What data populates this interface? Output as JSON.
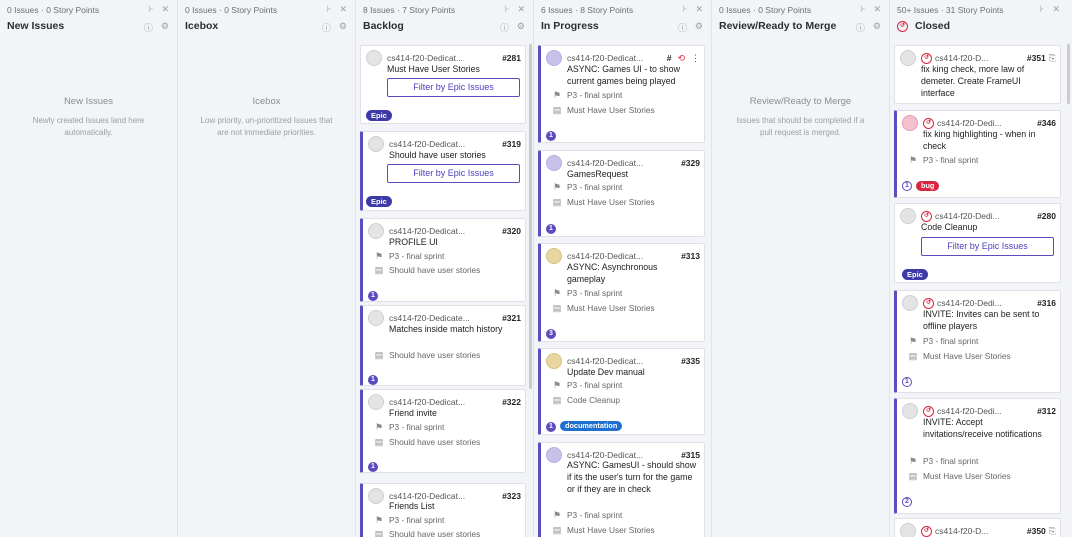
{
  "columns": {
    "new": {
      "meta": "0 Issues · 0 Story Points",
      "title": "New Issues",
      "empty_title": "New Issues",
      "empty_desc": "Newly created Issues land here automatically."
    },
    "icebox": {
      "meta": "0 Issues · 0 Story Points",
      "title": "Icebox",
      "empty_title": "Icebox",
      "empty_desc": "Low priority, un-prioritized Issues that are not immediate priorities."
    },
    "backlog": {
      "meta": "8 Issues · 7 Story Points",
      "title": "Backlog"
    },
    "progress": {
      "meta": "6 Issues · 8 Story Points",
      "title": "In Progress"
    },
    "review": {
      "meta": "0 Issues · 0 Story Points",
      "title": "Review/Ready to Merge",
      "empty_title": "Review/Ready to Merge",
      "empty_desc": "Issues that should be completed if a pull request is merged."
    },
    "closed": {
      "meta": "50+ Issues · 31 Story Points",
      "title": "Closed"
    }
  },
  "common": {
    "filter_epic": "Filter by Epic Issues",
    "epic": "Epic",
    "p3": "P3 - final sprint",
    "must": "Must Have User Stories",
    "should": "Should have user stories",
    "cleanup": "Code Cleanup"
  },
  "backlog_cards": [
    {
      "repo": "cs414-f20-Dedicat...",
      "num": "#281",
      "title": "Must Have User Stories"
    },
    {
      "repo": "cs414-f20-Dedicat...",
      "num": "#319",
      "title": "Should have user stories"
    },
    {
      "repo": "cs414-f20-Dedicat...",
      "num": "#320",
      "title": "PROFILE UI",
      "badge": "1"
    },
    {
      "repo": "cs414-f20-Dedicate...",
      "num": "#321",
      "title": "Matches inside match history",
      "badge": "1"
    },
    {
      "repo": "cs414-f20-Dedicat...",
      "num": "#322",
      "title": "Friend invite",
      "badge": "1"
    },
    {
      "repo": "cs414-f20-Dedicat...",
      "num": "#323",
      "title": "Friends List"
    }
  ],
  "progress_cards": [
    {
      "repo": "cs414-f20-Dedicat...",
      "num": "#",
      "title": "ASYNC: Games UI - to show current games being played",
      "badge": "1"
    },
    {
      "repo": "cs414-f20-Dedicat...",
      "num": "#329",
      "title": "GamesRequest",
      "badge": "1"
    },
    {
      "repo": "cs414-f20-Dedicat...",
      "num": "#313",
      "title": "ASYNC: Asynchronous gameplay",
      "badge": "3"
    },
    {
      "repo": "cs414-f20-Dedicat...",
      "num": "#335",
      "title": "Update Dev manual",
      "badge": "1",
      "label": "documentation"
    },
    {
      "repo": "cs414-f20-Dedicat...",
      "num": "#315",
      "title": "ASYNC: GamesUI - should show if its the user's turn for the game or if they are in check"
    }
  ],
  "closed_cards": [
    {
      "repo": "cs414-f20-D...",
      "num": "#351",
      "title": "fix king check, more law of demeter. Create FrameUI interface"
    },
    {
      "repo": "cs414-f20-Dedi...",
      "num": "#346",
      "title": "fix king highlighting - when in check",
      "badge": "1",
      "label": "bug"
    },
    {
      "repo": "cs414-f20-Dedi...",
      "num": "#280",
      "title": "Code Cleanup"
    },
    {
      "repo": "cs414-f20-Dedi...",
      "num": "#316",
      "title": "INVITE: Invites can be sent to offline players",
      "badge": "1"
    },
    {
      "repo": "cs414-f20-Dedi...",
      "num": "#312",
      "title": "INVITE: Accept invitations/receive notifications",
      "badge": "2"
    },
    {
      "repo": "cs414-f20-D...",
      "num": "#350"
    }
  ],
  "colors": {
    "epic": "#3d3aa8",
    "stripe": "#5b4cbf",
    "documentation": "#1f6fd0",
    "bug": "#d7263d",
    "closed_icon": "#d7263d"
  }
}
